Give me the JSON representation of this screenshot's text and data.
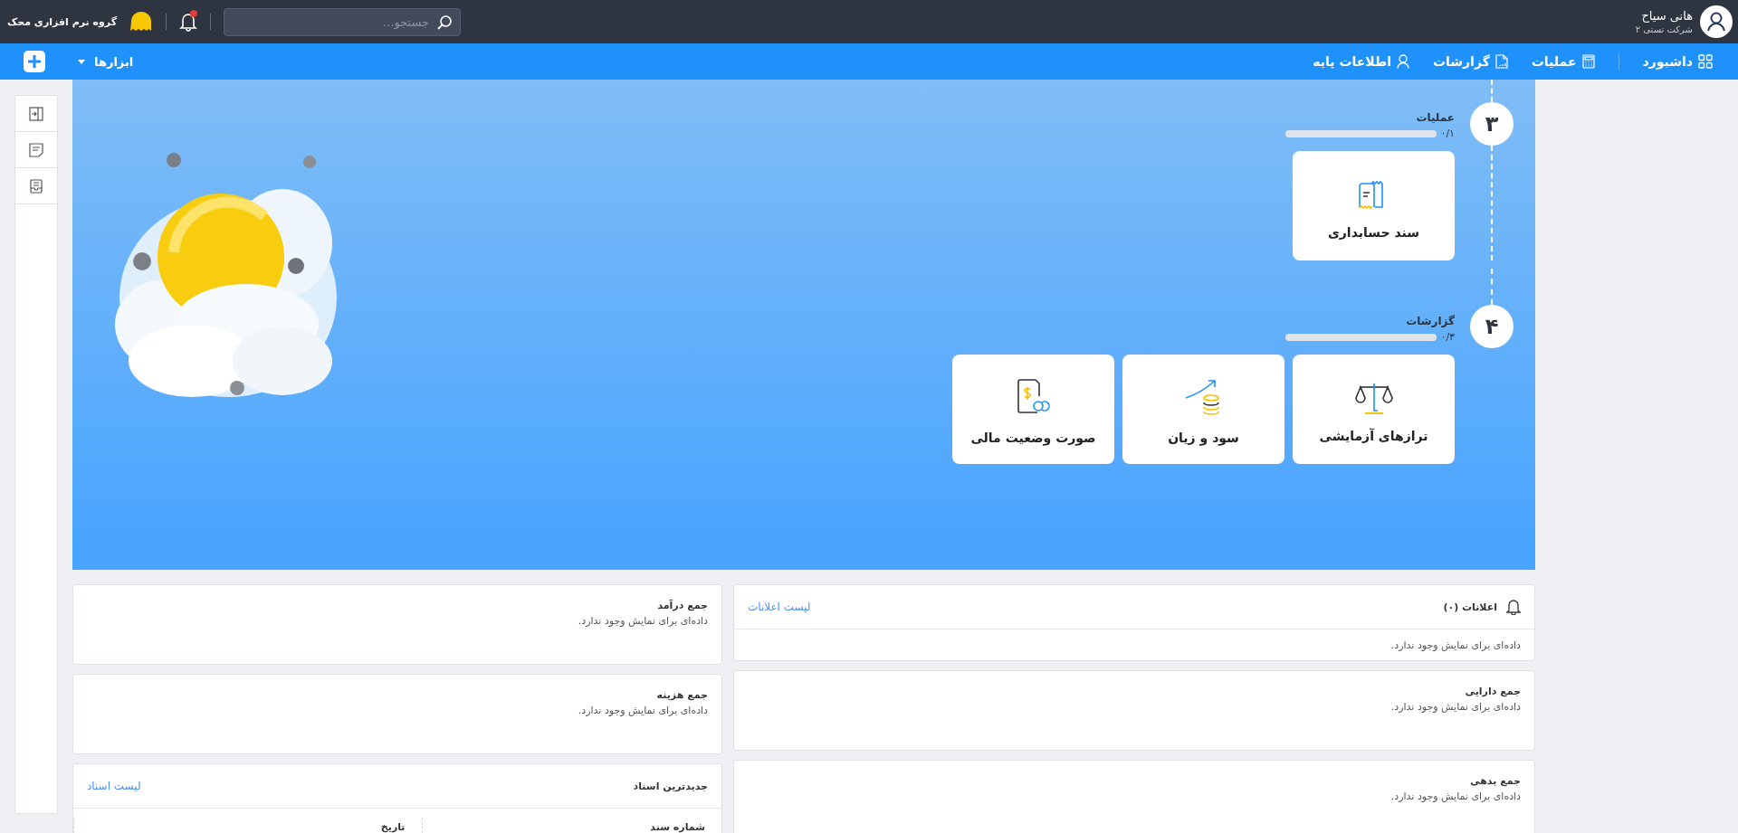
{
  "user": {
    "name": "هانی سیاح",
    "company": "شرکت تستی ۲"
  },
  "search": {
    "placeholder": "جستجو..."
  },
  "bell": {
    "unread": true
  },
  "brand": {
    "name": "گروه نرم افزاری محک"
  },
  "nav": {
    "items": [
      {
        "label": "داشبورد",
        "kind": "grid"
      },
      {
        "label": "عملیات",
        "kind": "calculator"
      },
      {
        "label": "گزارشات",
        "kind": "document"
      },
      {
        "label": "اطلاعات پایه",
        "kind": "user"
      }
    ],
    "tools": {
      "label": "ابزارها"
    }
  },
  "sidebar": {
    "tools": [
      {
        "kind": "collapse"
      },
      {
        "kind": "note"
      },
      {
        "kind": "tray"
      }
    ]
  },
  "steps": [
    {
      "number": "۳",
      "title": "عملیات",
      "progress": "۰/۱",
      "level": 0,
      "cards": [
        {
          "label": "سند حسابداری",
          "kind": "voucher"
        }
      ]
    },
    {
      "number": "۴",
      "title": "گزارشات",
      "progress": "۰/۳",
      "level": 0,
      "cards": [
        {
          "label": "ترازهای آزمایشی",
          "kind": "scale"
        },
        {
          "label": "سود و زیان",
          "kind": "coins"
        },
        {
          "label": "صورت وضعیت مالی",
          "kind": "statement"
        }
      ]
    }
  ],
  "widgets_right": [
    {
      "kind": "list",
      "title": "اعلانات (۰)",
      "link": "لیست اعلانات",
      "empty": "داده‌ای برای نمایش وجود ندارد."
    },
    {
      "kind": "summary",
      "title": "جمع دارایی",
      "empty": "داده‌ای برای نمایش وجود ندارد."
    },
    {
      "kind": "summary",
      "title": "جمع بدهی",
      "empty": "داده‌ای برای نمایش وجود ندارد."
    }
  ],
  "widgets_left": [
    {
      "kind": "summary",
      "title": "جمع درآمد",
      "empty": "داده‌ای برای نمایش وجود ندارد."
    },
    {
      "kind": "summary",
      "title": "جمع هزینه",
      "empty": "داده‌ای برای نمایش وجود ندارد."
    },
    {
      "kind": "table",
      "title": "جدیدترین اسناد",
      "link": "لیست اسناد",
      "columns": [
        "شماره سند",
        "تاریخ"
      ]
    }
  ]
}
